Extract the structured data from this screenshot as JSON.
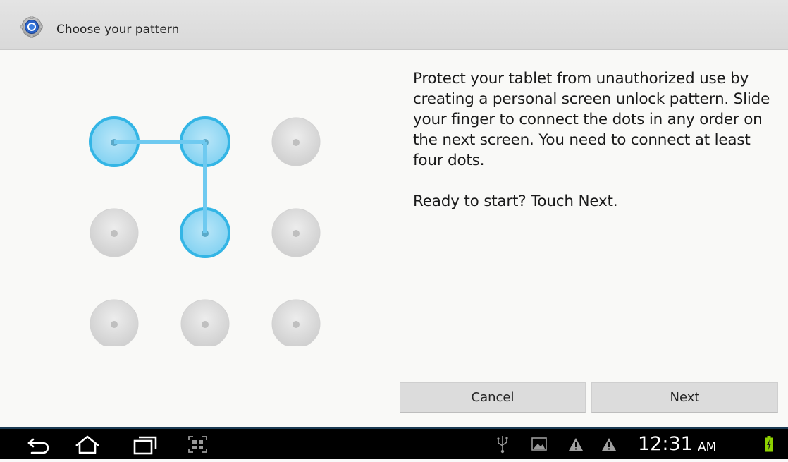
{
  "titlebar": {
    "title": "Choose your pattern",
    "icon": "settings-gear-icon"
  },
  "pattern": {
    "selected": [
      [
        0,
        0
      ],
      [
        0,
        1
      ],
      [
        1,
        1
      ]
    ],
    "grid": 3
  },
  "instructions": {
    "paragraph1": "Protect your tablet from unauthorized use by creating a personal screen unlock pattern. Slide your finger to connect the dots in any order on the next screen. You need to connect at least four dots.",
    "paragraph2": "Ready to start? Touch Next."
  },
  "buttons": {
    "cancel": "Cancel",
    "next": "Next"
  },
  "navbar": {
    "time": "12:31",
    "ampm": "AM",
    "icons": [
      "back-icon",
      "home-icon",
      "recent-apps-icon",
      "screenshot-icon",
      "usb-icon",
      "image-icon",
      "warning-icon",
      "warning-icon",
      "battery-charging-icon"
    ]
  },
  "colors": {
    "selected_dot": "#33b5e5",
    "line": "#6fcaf0",
    "unselected_dot": "#d9d9d9"
  }
}
